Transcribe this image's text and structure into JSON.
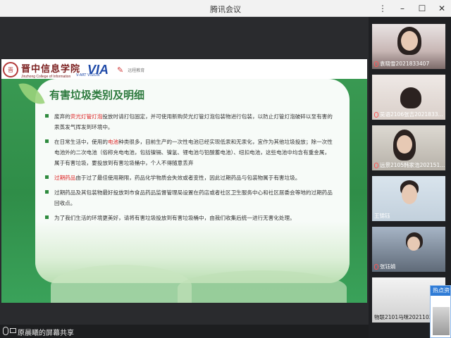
{
  "window": {
    "title": "腾讯会议"
  },
  "slide": {
    "school_cn": "晋中信息学院",
    "school_en": "Jinzhong College of Information",
    "seal_text": "晋",
    "partner_logo": "VIA",
    "partner_sub": "V-ART VISION",
    "brand_text": "远程教育",
    "title": "有害垃圾类别及明细",
    "bullets": [
      {
        "before": "废弃的",
        "highlight": "荧光灯管灯泡",
        "after": "投放时请打包固定，并可使用新购荧光灯管灯泡包装物进行包装，以防止灯管灯泡破碎以至有害的汞蒸发气挥发到环境中。"
      },
      {
        "before": "在日常生活中，使用的",
        "highlight": "电池",
        "after": "种类很多，目前生产的一次性电池已经实现低汞和无汞化，宜作为其他垃圾投放；除一次性电池外的二次电池（俗称充电电池，包括镍镉、镍氢、锂电池与铅酸蓄电池）、纽扣电池，这些电池中均含有重金属，属于有害垃圾，要投放到有害垃圾桶中，个人不得随意丢弃"
      },
      {
        "before": "",
        "highlight": "过期药品",
        "after": "由于过了最佳使用期限，药品化学物质会失效或者变性，因此过期药品与包装物属于有害垃圾。"
      },
      {
        "before": "过期药品及其包装物最好投放到市食品药品监督管理局设置在药店或者社区卫生服务中心和社区居委会等地的过期药品回收点。",
        "highlight": "",
        "after": ""
      },
      {
        "before": "为了我们生活的环境更美好，请将有害垃圾投放到有害垃圾桶中，由我们收集后统一进行无害化处理。",
        "highlight": "",
        "after": ""
      }
    ]
  },
  "status": {
    "share_label": "原晨曦的屏幕共享"
  },
  "participants": [
    {
      "name": "袁晓雪2021833407"
    },
    {
      "name": "吴语2106张吉2021833..."
    },
    {
      "name": "远景2105韩家浩202151..."
    },
    {
      "name": "王锦钰"
    },
    {
      "name": "张钰婧"
    },
    {
      "name": "物联2101马咪2021103..."
    }
  ],
  "popup": {
    "label": "热点资讯"
  }
}
